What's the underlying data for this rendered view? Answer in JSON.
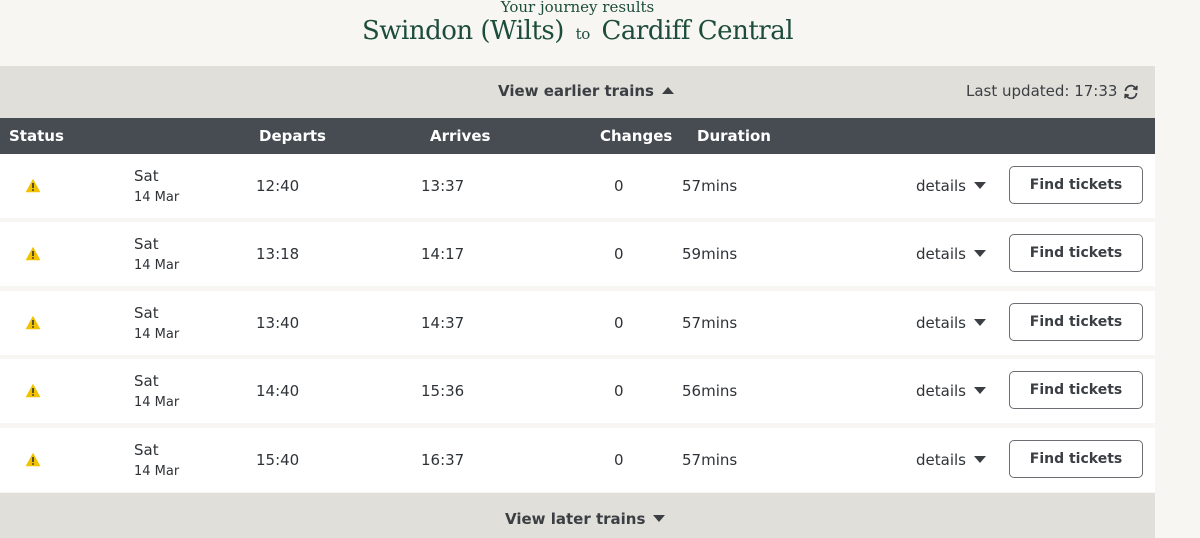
{
  "header": {
    "subtitle": "Your journey results",
    "origin": "Swindon (Wilts)",
    "to": "to",
    "destination": "Cardiff Central"
  },
  "earlier": {
    "label": "View earlier trains",
    "last_updated": "Last updated: 17:33"
  },
  "columns": {
    "status": "Status",
    "departs": "Departs",
    "arrives": "Arrives",
    "changes": "Changes",
    "duration": "Duration"
  },
  "journeys": [
    {
      "day": "Sat",
      "date": "14 Mar",
      "departs": "12:40",
      "arrives": "13:37",
      "changes": "0",
      "duration": "57mins",
      "details": "details",
      "button": "Find tickets"
    },
    {
      "day": "Sat",
      "date": "14 Mar",
      "departs": "13:18",
      "arrives": "14:17",
      "changes": "0",
      "duration": "59mins",
      "details": "details",
      "button": "Find tickets"
    },
    {
      "day": "Sat",
      "date": "14 Mar",
      "departs": "13:40",
      "arrives": "14:37",
      "changes": "0",
      "duration": "57mins",
      "details": "details",
      "button": "Find tickets"
    },
    {
      "day": "Sat",
      "date": "14 Mar",
      "departs": "14:40",
      "arrives": "15:36",
      "changes": "0",
      "duration": "56mins",
      "details": "details",
      "button": "Find tickets"
    },
    {
      "day": "Sat",
      "date": "14 Mar",
      "departs": "15:40",
      "arrives": "16:37",
      "changes": "0",
      "duration": "57mins",
      "details": "details",
      "button": "Find tickets"
    }
  ],
  "later": {
    "label": "View later trains"
  },
  "colors": {
    "title_green": "#1d4d3a",
    "header_dark": "#474c52",
    "bar_grey": "#e0dfd9",
    "warning_yellow": "#f2c200"
  },
  "icons": {
    "status": "warning-icon",
    "refresh": "refresh-icon"
  }
}
